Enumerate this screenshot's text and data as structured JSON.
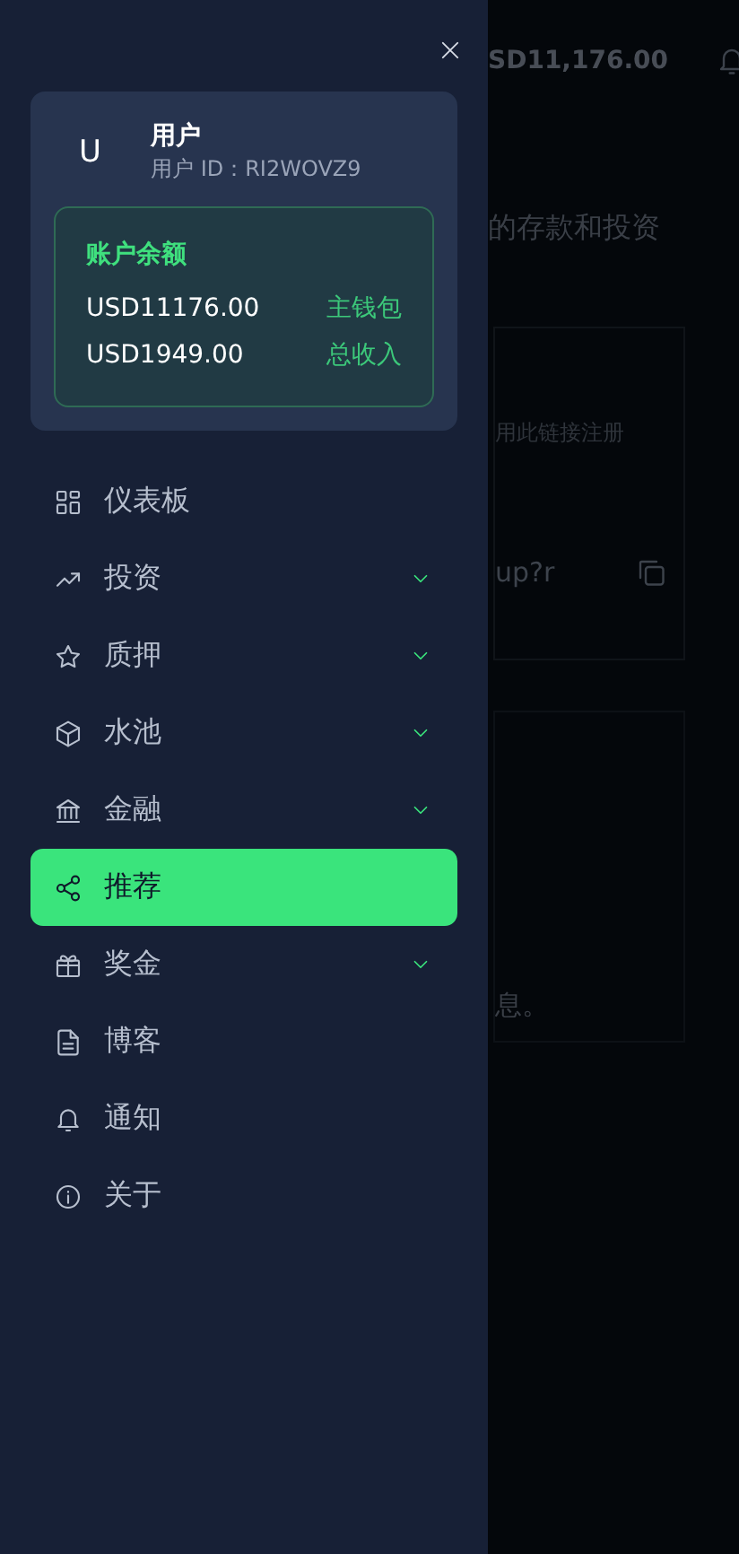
{
  "drawer": {
    "user": {
      "avatar": "U",
      "name": "用户",
      "id": "用户 ID：RI2WOVZ9"
    },
    "balance": {
      "title": "账户余额",
      "rows": [
        {
          "amount": "USD11176.00",
          "label": "主钱包"
        },
        {
          "amount": "USD1949.00",
          "label": "总收入"
        }
      ]
    },
    "menu": [
      {
        "label": "仪表板",
        "expandable": false,
        "selected": false
      },
      {
        "label": "投资",
        "expandable": true,
        "selected": false
      },
      {
        "label": "质押",
        "expandable": true,
        "selected": false
      },
      {
        "label": "水池",
        "expandable": true,
        "selected": false
      },
      {
        "label": "金融",
        "expandable": true,
        "selected": false
      },
      {
        "label": "推荐",
        "expandable": false,
        "selected": true
      },
      {
        "label": "奖金",
        "expandable": true,
        "selected": false
      },
      {
        "label": "博客",
        "expandable": false,
        "selected": false
      },
      {
        "label": "通知",
        "expandable": false,
        "selected": false
      },
      {
        "label": "关于",
        "expandable": false,
        "selected": false
      }
    ]
  },
  "background": {
    "header_balance": "SD11,176.00",
    "subtitle": "的存款和投资",
    "referral_hint": "用此链接注册",
    "referral_link": "up?r",
    "note": "息。"
  }
}
